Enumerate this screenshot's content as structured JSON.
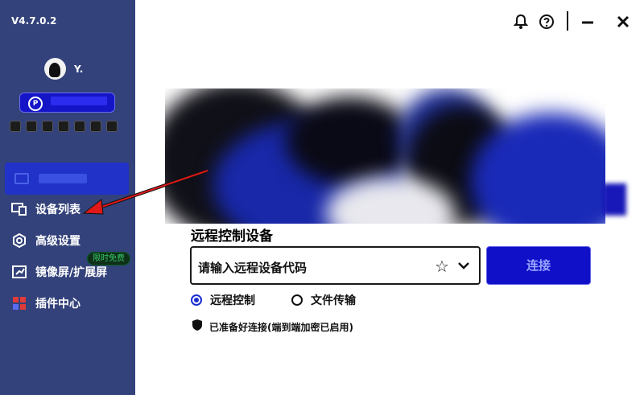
{
  "app": {
    "version": "V4.7.0.2"
  },
  "user": {
    "name": "Y."
  },
  "sidebar": {
    "items": [
      {
        "label": "设备列表",
        "icon": "devices-icon"
      },
      {
        "label": "高级设置",
        "icon": "settings-gear-icon"
      },
      {
        "label": "镜像屏/扩展屏",
        "icon": "screen-mirror-icon",
        "badge": "限时免费"
      },
      {
        "label": "插件中心",
        "icon": "plugin-grid-icon"
      }
    ]
  },
  "main": {
    "section_title": "远程控制设备",
    "code_input": {
      "placeholder": "请输入远程设备代码"
    },
    "connect_label": "连接",
    "modes": [
      {
        "label": "远程控制",
        "selected": true
      },
      {
        "label": "文件传输",
        "selected": false
      }
    ],
    "status_text": "已准备好连接(端到端加密已启用)"
  },
  "colors": {
    "sidebar_bg": "#33427a",
    "accent": "#1515c8",
    "annotation_arrow": "#e01818"
  }
}
